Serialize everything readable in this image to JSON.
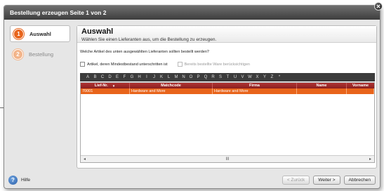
{
  "window": {
    "title": "Bestellung erzeugen Seite 1 von 2",
    "close_glyph": "✕"
  },
  "nav": {
    "items": [
      {
        "number": "1",
        "label": "Auswahl"
      },
      {
        "number": "2",
        "label": "Bestellung"
      }
    ]
  },
  "panel": {
    "title": "Auswahl",
    "subtitle": "Wählen Sie einen Lieferanten aus, um die Bestellung zu erzeugen.",
    "question": "Welche Artikel des unten ausgewählten Lieferanten sollten bestellt werden?",
    "checkbox_min": "Artikel, deren Mindestbestand unterschritten ist",
    "checkbox_ordered": "Bereits bestellte Ware berücksichtigen"
  },
  "alphabet": [
    "A",
    "B",
    "C",
    "D",
    "E",
    "F",
    "G",
    "H",
    "I",
    "J",
    "K",
    "L",
    "M",
    "N",
    "O",
    "P",
    "Q",
    "R",
    "S",
    "T",
    "U",
    "V",
    "W",
    "X",
    "Y",
    "Z",
    "*"
  ],
  "table": {
    "columns": [
      "Lief-Nr.",
      "Matchcode",
      "Firma",
      "Name",
      "Vorname"
    ],
    "sort_glyph": "▼",
    "rows": [
      {
        "lief_nr": "70001",
        "matchcode": "Hardware and More",
        "firma": "Hardware and More",
        "name": "",
        "vorname": ""
      }
    ],
    "scroll_left": "◂",
    "scroll_thumb": "III",
    "scroll_right": "▸"
  },
  "footer": {
    "help_glyph": "?",
    "help_label": "Hilfe",
    "back_label": "< Zurück",
    "next_label": "Weiter >",
    "cancel_label": "Abbrechen"
  },
  "colors": {
    "accent": "#e8641b",
    "header_row": "#a52a2a",
    "titlebar": "#4a4a4a"
  }
}
